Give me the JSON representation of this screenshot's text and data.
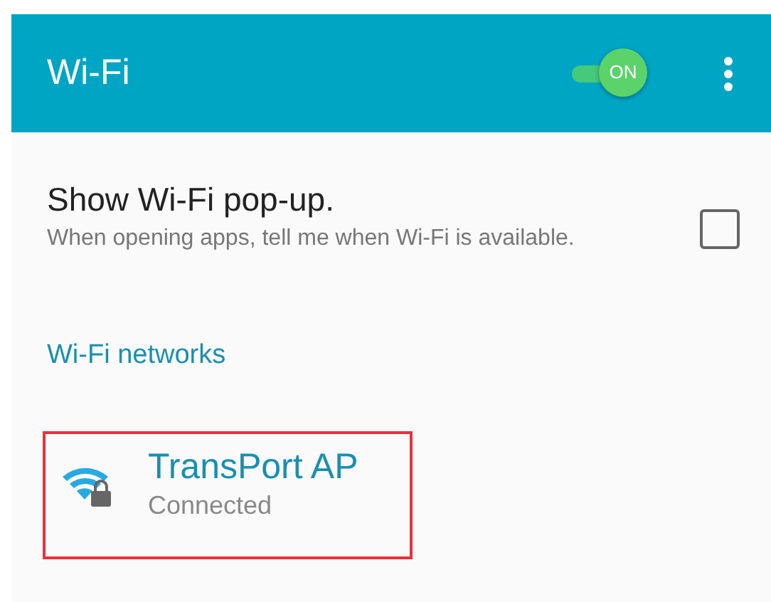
{
  "header": {
    "title": "Wi-Fi",
    "switch": {
      "label": "ON",
      "on": true
    }
  },
  "popup_setting": {
    "title": "Show Wi-Fi pop-up.",
    "description": "When opening apps, tell me when Wi-Fi is available.",
    "checked": false
  },
  "section_title": "Wi-Fi networks",
  "networks": [
    {
      "name": "TransPort AP",
      "status": "Connected",
      "secured": true,
      "highlighted": true
    }
  ]
}
